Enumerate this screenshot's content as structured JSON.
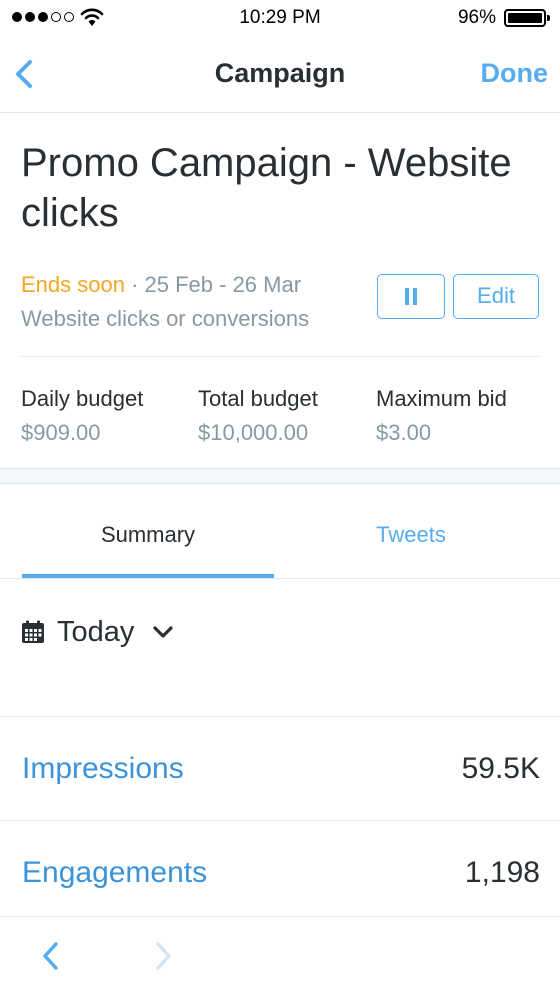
{
  "status_bar": {
    "time": "10:29 PM",
    "battery": "96%"
  },
  "nav": {
    "title": "Campaign",
    "done": "Done"
  },
  "campaign": {
    "title": "Promo Campaign - Website clicks",
    "status": "Ends soon",
    "separator": " · ",
    "dates": "25 Feb - 26 Mar",
    "objective": "Website clicks or conversions",
    "edit_label": "Edit"
  },
  "budgets": [
    {
      "label": "Daily budget",
      "value": "$909.00"
    },
    {
      "label": "Total budget",
      "value": "$10,000.00"
    },
    {
      "label": "Maximum bid",
      "value": "$3.00"
    }
  ],
  "tabs": [
    {
      "label": "Summary",
      "active": true
    },
    {
      "label": "Tweets",
      "active": false
    }
  ],
  "date_range": "Today",
  "metrics": [
    {
      "label": "Impressions",
      "value": "59.5K"
    },
    {
      "label": "Engagements",
      "value": "1,198"
    }
  ],
  "colors": {
    "accent": "#55acee",
    "ends_soon": "#f5a623",
    "secondary_text": "#8899a6",
    "primary_text": "#292f33"
  },
  "icons": [
    "wifi-icon",
    "battery-icon",
    "back-chevron-icon",
    "pause-icon",
    "calendar-icon",
    "chevron-down-icon",
    "forward-chevron-icon"
  ]
}
